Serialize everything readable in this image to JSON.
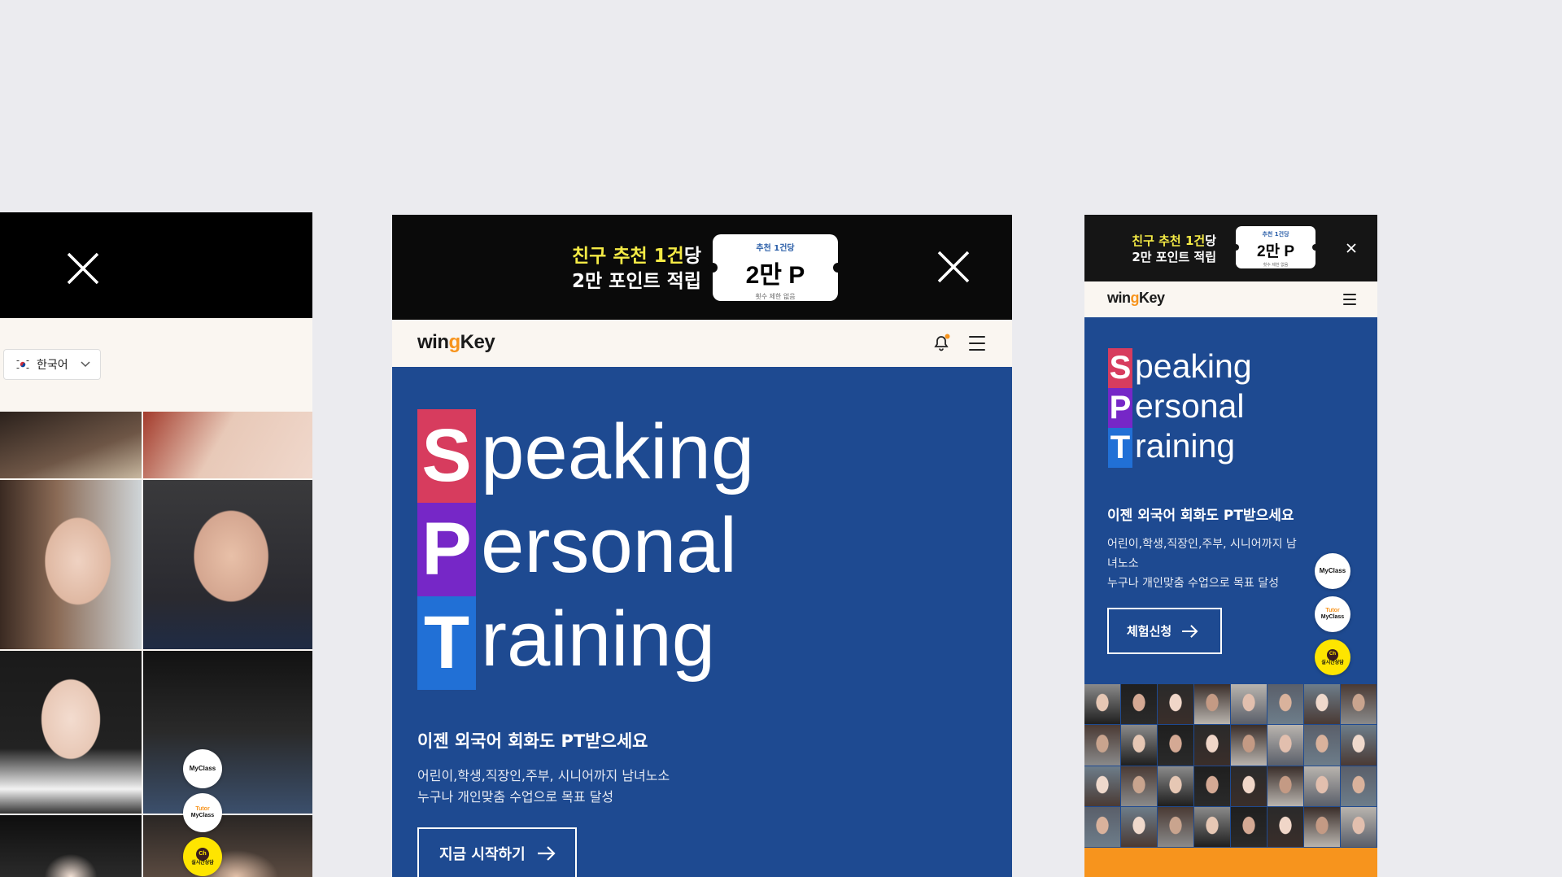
{
  "promo": {
    "line1_highlight": "친구 추천 1건",
    "line1_rest": "당",
    "line2": "2만 포인트 적립",
    "ticket_small": "추천 1건당",
    "ticket_big": "2만 P",
    "ticket_tiny": "횟수 제한 없음"
  },
  "brand": {
    "logo_pre": "win",
    "logo_mid": "g",
    "logo_post": "Key"
  },
  "language": {
    "selected": "한국어"
  },
  "hero": {
    "line1_cap": "S",
    "line1_rest": "peaking",
    "line2_cap": "P",
    "line2_rest": "ersonal",
    "line3_cap": "T",
    "line3_rest": "raining",
    "subhead": "이젠 외국어 회화도 PT받으세요",
    "desc_line1": "어린이,학생,직장인,주부, 시니어까지 남녀노소",
    "desc_line2": "누구나 개인맞춤 수업으로 목표 달성",
    "desc_r1": "어린이,학생,직장인,주부, 시니어까지 남",
    "desc_r2": "녀노소",
    "desc_r3": "누구나 개인맞춤 수업으로 목표 달성",
    "cta_mid": "지금 시작하기",
    "cta_right": "체험신청"
  },
  "float_buttons": {
    "myclass": "MyClass",
    "tutor_top": "Tutor",
    "tutor_bottom": "MyClass",
    "chat_icon": "Ch",
    "chat_label": "실시간상담"
  },
  "icons": [
    "close-icon",
    "bell-icon",
    "menu-icon",
    "arrow-right-icon",
    "chevron-down-icon",
    "korea-flag-icon"
  ],
  "colors": {
    "hero_bg": "#1e4a91",
    "s_block": "#d73c5e",
    "p_block": "#7627c7",
    "t_block": "#2170d6",
    "promo_yellow": "#f4ea45",
    "brand_orange": "#f7941d"
  }
}
